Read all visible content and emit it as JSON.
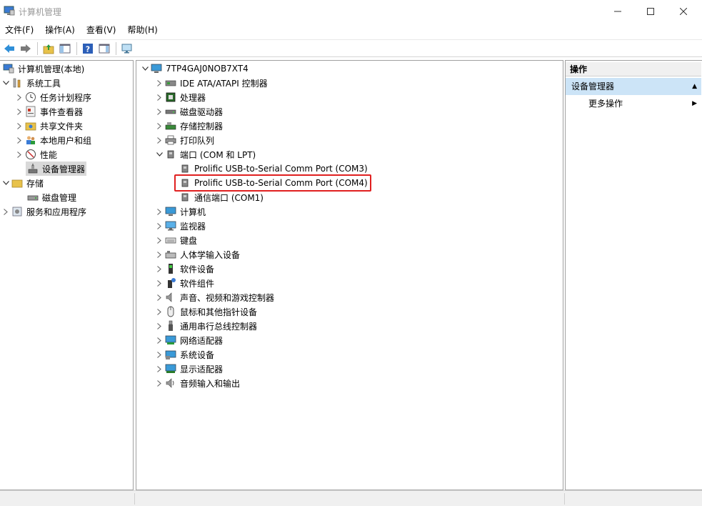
{
  "window": {
    "title": "计算机管理"
  },
  "menubar": {
    "items": [
      "文件(F)",
      "操作(A)",
      "查看(V)",
      "帮助(H)"
    ]
  },
  "toolbar": {
    "icons": [
      "back-icon",
      "forward-icon",
      "up-folder-icon",
      "show-hide-tree-icon",
      "help-icon",
      "properties-view-icon",
      "monitor-icon"
    ]
  },
  "left_tree": {
    "root": "计算机管理(本地)",
    "system_tools": "系统工具",
    "task_scheduler": "任务计划程序",
    "event_viewer": "事件查看器",
    "shared_folders": "共享文件夹",
    "local_users": "本地用户和组",
    "performance": "性能",
    "device_manager": "设备管理器",
    "storage": "存储",
    "disk_management": "磁盘管理",
    "services_apps": "服务和应用程序"
  },
  "device_tree": {
    "computer_name": "7TP4GAJ0NOB7XT4",
    "categories": [
      {
        "label": "IDE ATA/ATAPI 控制器",
        "icon": "ide-controller-icon"
      },
      {
        "label": "处理器",
        "icon": "processor-icon"
      },
      {
        "label": "磁盘驱动器",
        "icon": "disk-drive-icon"
      },
      {
        "label": "存储控制器",
        "icon": "storage-controller-icon"
      },
      {
        "label": "打印队列",
        "icon": "printer-icon"
      },
      {
        "label": "端口 (COM 和 LPT)",
        "icon": "port-icon"
      }
    ],
    "ports": [
      "Prolific USB-to-Serial Comm Port (COM3)",
      "Prolific USB-to-Serial Comm Port (COM4)",
      "通信端口 (COM1)"
    ],
    "more_categories": [
      {
        "label": "计算机",
        "icon": "computer-icon"
      },
      {
        "label": "监视器",
        "icon": "monitor-icon"
      },
      {
        "label": "键盘",
        "icon": "keyboard-icon"
      },
      {
        "label": "人体学输入设备",
        "icon": "hid-icon"
      },
      {
        "label": "软件设备",
        "icon": "software-device-icon"
      },
      {
        "label": "软件组件",
        "icon": "software-component-icon"
      },
      {
        "label": "声音、视频和游戏控制器",
        "icon": "sound-icon"
      },
      {
        "label": "鼠标和其他指针设备",
        "icon": "mouse-icon"
      },
      {
        "label": "通用串行总线控制器",
        "icon": "usb-icon"
      },
      {
        "label": "网络适配器",
        "icon": "network-adapter-icon"
      },
      {
        "label": "系统设备",
        "icon": "system-device-icon"
      },
      {
        "label": "显示适配器",
        "icon": "display-adapter-icon"
      },
      {
        "label": "音频输入和输出",
        "icon": "audio-io-icon"
      }
    ]
  },
  "actions": {
    "header": "操作",
    "section": "设备管理器",
    "more_actions": "更多操作"
  },
  "colors": {
    "highlight_border": "#e02020",
    "selected_bg": "#d9d9d9",
    "action_section_bg": "#cce4f7"
  }
}
